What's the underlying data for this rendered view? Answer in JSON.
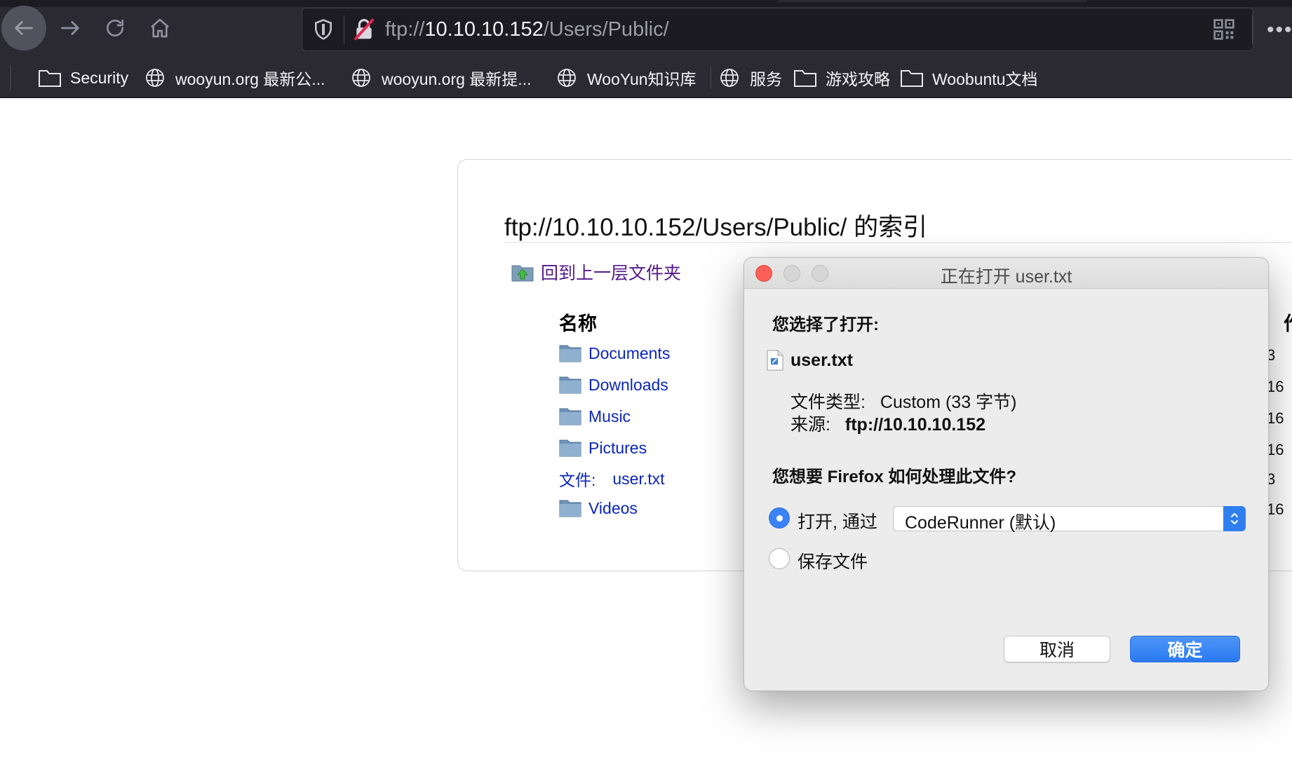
{
  "browser": {
    "url_scheme": "ftp://",
    "url_host": "10.10.10.152",
    "url_path": "/Users/Public/",
    "bookmarks": [
      {
        "label": "Security",
        "icon": "folder-icon"
      },
      {
        "label": "wooyun.org 最新公...",
        "icon": "globe-icon"
      },
      {
        "label": "wooyun.org 最新提...",
        "icon": "globe-icon"
      },
      {
        "label": "WooYun知识库",
        "icon": "globe-icon"
      },
      {
        "label": "服务",
        "icon": "globe-icon"
      },
      {
        "label": "游戏攻略",
        "icon": "folder-icon"
      },
      {
        "label": "Woobuntu文档",
        "icon": "folder-icon"
      }
    ]
  },
  "listing": {
    "title": "ftp://10.10.10.152/Users/Public/ 的索引",
    "up_link": "回到上一层文件夹",
    "name_header": "名称",
    "right_header_fragment": "作",
    "file_prefix": "文件:",
    "entries": [
      {
        "name": "Documents",
        "type": "folder",
        "size_fragment": "3"
      },
      {
        "name": "Downloads",
        "type": "folder",
        "size_fragment": "16"
      },
      {
        "name": "Music",
        "type": "folder",
        "size_fragment": "16"
      },
      {
        "name": "Pictures",
        "type": "folder",
        "size_fragment": "16"
      },
      {
        "name": "user.txt",
        "type": "file",
        "size_fragment": "3"
      },
      {
        "name": "Videos",
        "type": "folder",
        "size_fragment": "16"
      }
    ]
  },
  "dialog": {
    "title": "正在打开 user.txt",
    "chosen_label": "您选择了打开:",
    "filename": "user.txt",
    "type_label": "文件类型:",
    "type_value": "Custom (33 字节)",
    "source_label": "来源:",
    "source_value": "ftp://10.10.10.152",
    "question": "您想要 Firefox 如何处理此文件?",
    "open_with_label": "打开, 通过",
    "open_with_app": "CodeRunner (默认)",
    "save_label": "保存文件",
    "open_selected": true,
    "cancel_label": "取消",
    "ok_label": "确定",
    "accent": "#2f7ff0"
  }
}
